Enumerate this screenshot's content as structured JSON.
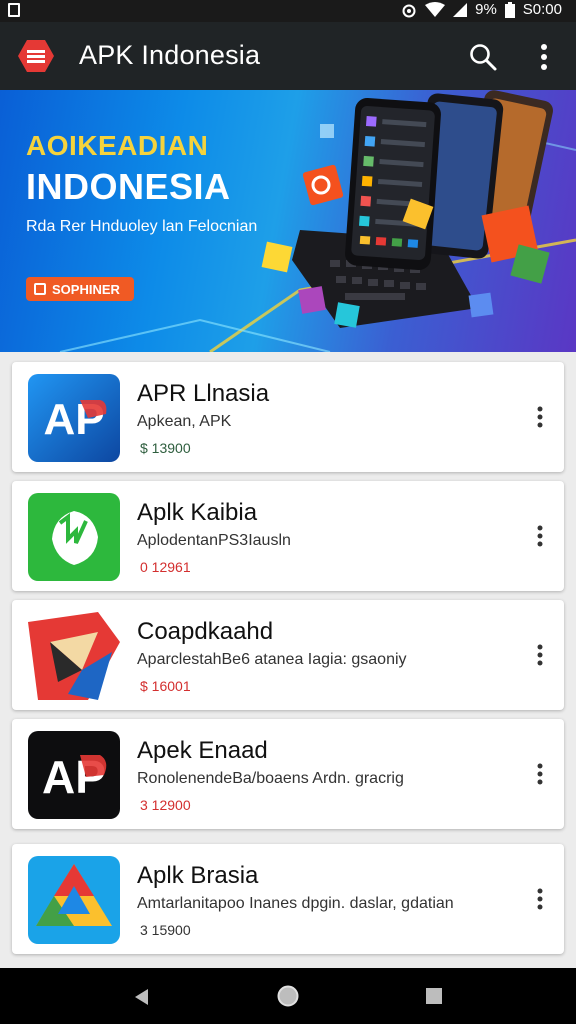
{
  "status_bar": {
    "battery": "9%",
    "time": "S0:00"
  },
  "app_bar": {
    "title": "APK Indonesia",
    "logo_icon": "menu-stripes-logo",
    "search_icon": "search-icon",
    "more_icon": "more-vert-icon"
  },
  "banner": {
    "kicker": "AOIKEADIAN",
    "headline": "INDONESIA",
    "tagline": "Rda Rer Hnduoley lan Felocnian",
    "cta": "SOPHINER",
    "colors": {
      "kicker": "#f5d33d",
      "cta": "#f05a24"
    }
  },
  "apps": [
    {
      "name": "APR Llnasia",
      "subtitle": "Apkean, APK",
      "price": "$ 13900",
      "price_color": "#2e5e3e",
      "icon": "ap-blue-logo"
    },
    {
      "name": "Aplk Kaibia",
      "subtitle": "AplodentanPS3Iausln",
      "price": "0 12961",
      "price_color": "#d32f2f",
      "icon": "green-shield-logo"
    },
    {
      "name": "Coapdkaahd",
      "subtitle": "AparclestahBe6 atanea Iagia: gsaoniy",
      "price": "$ 16001",
      "price_color": "#d32f2f",
      "icon": "red-origami-logo"
    },
    {
      "name": "Apek Enaad",
      "subtitle": "RonolenendeBa/boaens Ardn. gracrig",
      "price": "3 12900",
      "price_color": "#d32f2f",
      "icon": "ap-black-logo"
    },
    {
      "name": "Aplk Brasia",
      "subtitle": "Amtarlanitapoo Inanes dpgin. daslar, gdatian",
      "price": "3 15900",
      "price_color": "#333333",
      "icon": "multicolor-shape-logo"
    }
  ],
  "nav_bar": {
    "back_icon": "back-triangle-icon",
    "home_icon": "home-circle-icon",
    "recent_icon": "recent-square-icon"
  }
}
